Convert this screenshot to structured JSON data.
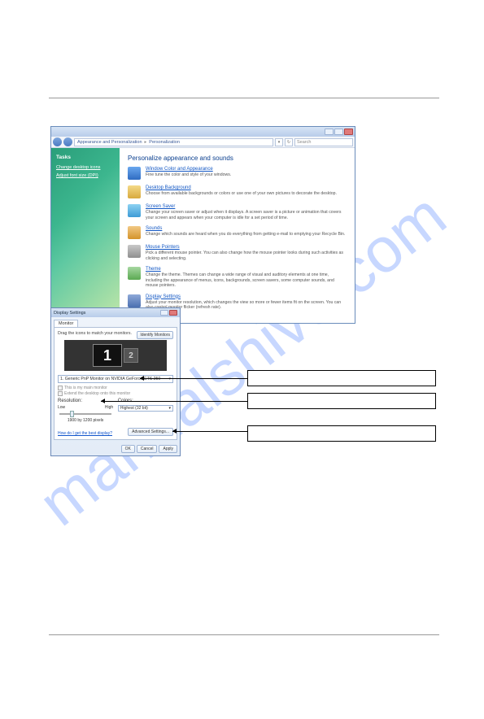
{
  "watermark": "manualshive.com",
  "win1": {
    "breadcrumb1": "Appearance and Personalization",
    "breadcrumb2": "Personalization",
    "search_ph": "Search",
    "sidebar_head": "Tasks",
    "sidebar_link1": "Change desktop icons",
    "sidebar_link2": "Adjust font size (DPI)",
    "heading": "Personalize appearance and sounds",
    "items": [
      {
        "title": "Window Color and Appearance",
        "desc": "Fine tune the color and style of your windows."
      },
      {
        "title": "Desktop Background",
        "desc": "Choose from available backgrounds or colors or use one of your own pictures to decorate the desktop."
      },
      {
        "title": "Screen Saver",
        "desc": "Change your screen saver or adjust when it displays. A screen saver is a picture or animation that covers your screen and appears when your computer is idle for a set period of time."
      },
      {
        "title": "Sounds",
        "desc": "Change which sounds are heard when you do everything from getting e-mail to emptying your Recycle Bin."
      },
      {
        "title": "Mouse Pointers",
        "desc": "Pick a different mouse pointer. You can also change how the mouse pointer looks during such activities as clicking and selecting."
      },
      {
        "title": "Theme",
        "desc": "Change the theme. Themes can change a wide range of visual and auditory elements at one time, including the appearance of menus, icons, backgrounds, screen savers, some computer sounds, and mouse pointers."
      },
      {
        "title": "Display Settings",
        "desc": "Adjust your monitor resolution, which changes the view so more or fewer items fit on the screen. You can also control monitor flicker (refresh rate)."
      }
    ]
  },
  "win2": {
    "title": "Display Settings",
    "tab": "Monitor",
    "hint": "Drag the icons to match your monitors.",
    "identify": "Identify Monitors",
    "mon1": "1",
    "mon2": "2",
    "select": "1. Generic PnP Monitor on NVIDIA GeForce GTS 250",
    "chk1": "This is my main monitor",
    "chk2": "Extend the desktop onto this monitor",
    "res_label": "Resolution:",
    "low": "Low",
    "high": "High",
    "res_value": "1900 by 1200 pixels",
    "colors_label": "Colors:",
    "colors_value": "Highest (32 bit)",
    "howlink": "How do I get the best display?",
    "adv": "Advanced Settings...",
    "ok": "OK",
    "cancel": "Cancel",
    "apply": "Apply"
  }
}
